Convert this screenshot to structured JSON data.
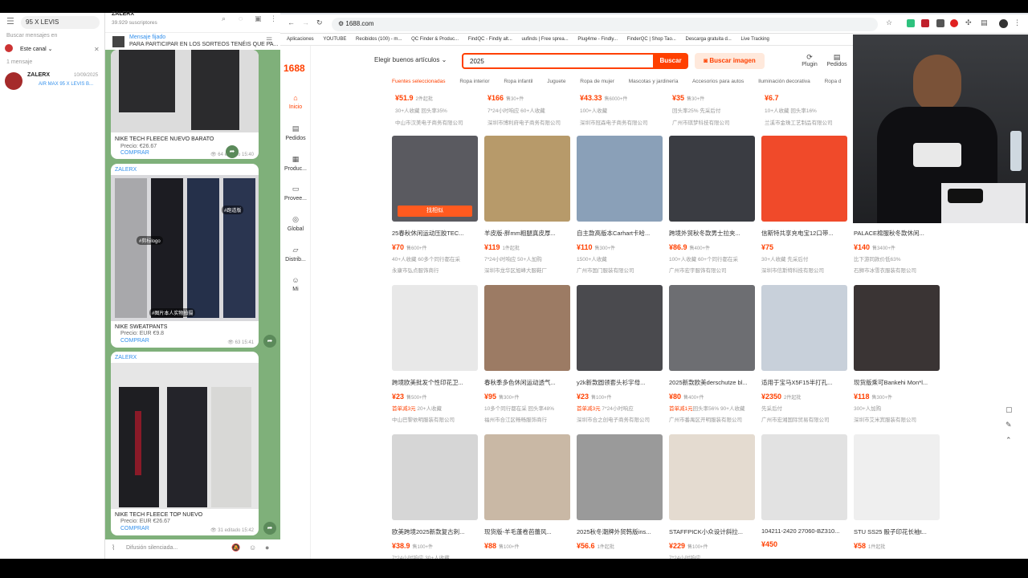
{
  "telegram": {
    "search_value": "95 X LEVIS",
    "search_messages_label": "Buscar mensajes en",
    "scope_label": "Este canal",
    "results_count": "1 mensaje",
    "result": {
      "name": "ZALERX",
      "date": "10/09/2025",
      "snippet": "AIR MAX 95 X LEVIS B..."
    },
    "channel": {
      "name": "ZALERX",
      "subscribers": "39.929 suscriptores"
    },
    "pinned": {
      "title": "Mensaje fijado",
      "text": "PARA PARTICIPAR EN LOS SORTEOS TENÉIS QUE PA..."
    },
    "messages": [
      {
        "sender": "",
        "title": "NIKE TECH FLEECE NUEVO BARATO",
        "price": "Precio: €26.67",
        "buy": "COMPRAR",
        "views": "64",
        "time": "editado 15:40"
      },
      {
        "sender": "ZALERX",
        "title": "NIKE SWEATPANTS",
        "price": "Precio: EUR €9.8",
        "buy": "COMPRAR",
        "views": "63",
        "time": "15:41",
        "tags": [
          "#跑道版",
          "#剪标logo",
          "#图片本人实物拍摄"
        ]
      },
      {
        "sender": "ZALERX",
        "title": "NIKE TECH FLEECE TOP NUEVO",
        "price": "Precio: EUR €26.67",
        "buy": "COMPRAR",
        "views": "31",
        "time": "editado 15:42"
      }
    ],
    "compose_placeholder": "Difusión silenciada..."
  },
  "browser": {
    "url": "1688.com",
    "bookmarks": [
      "Aplicaciones",
      "YOUTUBE",
      "Recibidos (100) - m...",
      "QC Finder & Produc...",
      "FindQC - Findly alt...",
      "uufinds | Free sprea...",
      "Plug4me - Findly...",
      "FinderQC | Shop Tao...",
      "Descarga gratuita d...",
      "Live Tracking"
    ]
  },
  "site": {
    "logo": "1688",
    "rail": [
      {
        "icon": "home-icon",
        "label": "Inicio",
        "active": true
      },
      {
        "icon": "orders-icon",
        "label": "Pedidos"
      },
      {
        "icon": "products-icon",
        "label": "Produc..."
      },
      {
        "icon": "suppliers-icon",
        "label": "Provee..."
      },
      {
        "icon": "global-icon",
        "label": "Global"
      },
      {
        "icon": "distribution-icon",
        "label": "Distrib..."
      },
      {
        "icon": "me-icon",
        "label": "Mi"
      }
    ],
    "category_select": "Elegir buenos artículos",
    "search_value": "2025",
    "search_button": "Buscar",
    "image_search_button": "Buscar imagen",
    "plugin_label": "Plugin",
    "orders_label": "Pedidos",
    "categories": [
      "Fuentes seleccionadas",
      "Ropa interior",
      "Ropa infantil",
      "Juguete",
      "Ropa de mujer",
      "Mascotas y jardinería",
      "Accesorios para autos",
      "Iluminación decorativa",
      "Ropa d"
    ],
    "top_row": [
      {
        "price": "¥51.9",
        "moq": "2件起批",
        "l1": "30+人收藏 回头率35%",
        "l2": "中山市汉美电子商务有限公司"
      },
      {
        "price": "¥166",
        "moq": "售30+件",
        "l1": "7*24小时响应 60+人收藏",
        "l2": "深圳市博利府电子商务有限公司"
      },
      {
        "price": "¥43.33",
        "moq": "售6000+件",
        "l1": "100+人收藏",
        "l2": "深圳市冠森电子商务有限公司"
      },
      {
        "price": "¥35",
        "moq": "售30+件",
        "l1": "回头率25% 先采后付",
        "l2": "广州市琪梦科技有限公司"
      },
      {
        "price": "¥6.7",
        "moq": "",
        "l1": "10+人收藏 回头率16%",
        "l2": "兰溪市金珠工艺制品有限公司"
      }
    ],
    "products": [
      {
        "title": "25春秋休闲运动压胶TEC...",
        "price": "¥70",
        "moq": "售600+件",
        "l1": "40+人收藏 60多个同行都在采",
        "l2": "永康市弘点服饰商行",
        "img_color": "#5a5a60",
        "overlay": "找相似"
      },
      {
        "title": "羊皮版-胖mm粗腿真皮厚...",
        "price": "¥119",
        "moq": "1件起批",
        "l1": "7*24小时响应 50+人加购",
        "l2": "深圳市龙华区旭峰大服鞋厂",
        "img_color": "#b79a6a"
      },
      {
        "title": "自主款高版本Carhart卡哈...",
        "price": "¥110",
        "moq": "售300+件",
        "l1": "1500+人收藏",
        "l2": "广州市国门服装有限公司",
        "img_color": "#8aa0b8"
      },
      {
        "title": "跨境外贸秋冬款男士拉夹...",
        "price": "¥86.9",
        "moq": "售400+件",
        "l1": "100+人收藏 60+个同行都在采",
        "l2": "广州市宏宇服饰有限公司",
        "img_color": "#3a3c42"
      },
      {
        "title": "信斯特共享充电宝12口带...",
        "price": "¥75",
        "moq": "",
        "l1": "30+人收藏 先采后付",
        "l2": "深圳市信斯特科技有限公司",
        "img_color": "#f04a2a"
      },
      {
        "title": "PALACE棉服秋冬款休闲...",
        "price": "¥140",
        "moq": "售3400+件",
        "l1": "比下游同款价低63%",
        "l2": "石狮市冰雪衣服装有限公司",
        "img_color": "#cfcfcf"
      },
      {
        "title": "跨境欧美批发个性印花卫...",
        "price": "¥23",
        "moq": "售500+件",
        "l1": "首单减3元 20+人收藏",
        "l2": "中山巴黎依明服装有限公司",
        "img_color": "#e8e8e8",
        "l1_red": "首单减3元"
      },
      {
        "title": "春秋季多色休闲运动透气...",
        "price": "¥95",
        "moq": "售300+件",
        "l1": "10多个同行都在采 回头率48%",
        "l2": "福州市合江区畅畅服饰商行",
        "img_color": "#9c7b64"
      },
      {
        "title": "y2k新款圆领套头衫宇母...",
        "price": "¥23",
        "moq": "售100+件",
        "l1": "首单减3元 7*24小时响应",
        "l2": "深圳市合之创电子商务有限公司",
        "img_color": "#4a4a4e",
        "l1_red": "首单减3元"
      },
      {
        "title": "2025新款欧美derschutze bl...",
        "price": "¥80",
        "moq": "售400+件",
        "l1": "首单减1元回头率56% 90+人收藏",
        "l2": "广州市番禺区开明服装有限公司",
        "img_color": "#6d6e72",
        "l1_red": "首单减1元"
      },
      {
        "title": "适用于宝马X5F15半打孔...",
        "price": "¥2350",
        "moq": "2件起批",
        "l1": "先采后付",
        "l2": "广州市宏湘国际贸易有限公司",
        "img_color": "#c8d0da"
      },
      {
        "title": "现货版乘可Bankehi Mon*l...",
        "price": "¥118",
        "moq": "售300+件",
        "l1": "300+人加购",
        "l2": "深圳市艾米宾服装有限公司",
        "img_color": "#3a3434"
      },
      {
        "title": "欧美跨境2025新款复古刺...",
        "price": "¥38.9",
        "moq": "售100+件",
        "l1": "7*24小时响应 30+人收藏",
        "l2": "",
        "img_color": "#d6d6d6"
      },
      {
        "title": "现货版-羊毛蓬卷芭蕾风...",
        "price": "¥88",
        "moq": "售100+件",
        "l1": "",
        "l2": "",
        "img_color": "#c9b8a5"
      },
      {
        "title": "2025秋冬潮牌外贸韩版ins...",
        "price": "¥56.6",
        "moq": "1件起批",
        "l1": "",
        "l2": "",
        "img_color": "#9a9a9a"
      },
      {
        "title": "STAFFPICK小众设计斜拉...",
        "price": "¥229",
        "moq": "售100+件",
        "l1": "7*24小时响应",
        "l2": "",
        "img_color": "#e4dbd0"
      },
      {
        "title": "104211-2420 27060-BZ310...",
        "price": "¥450",
        "moq": "",
        "l1": "",
        "l2": "",
        "img_color": "#e2e2e2"
      },
      {
        "title": "STU SS25 骰子印花长袖t...",
        "price": "¥58",
        "moq": "1件起批",
        "l1": "",
        "l2": "",
        "img_color": "#efefef"
      }
    ]
  }
}
